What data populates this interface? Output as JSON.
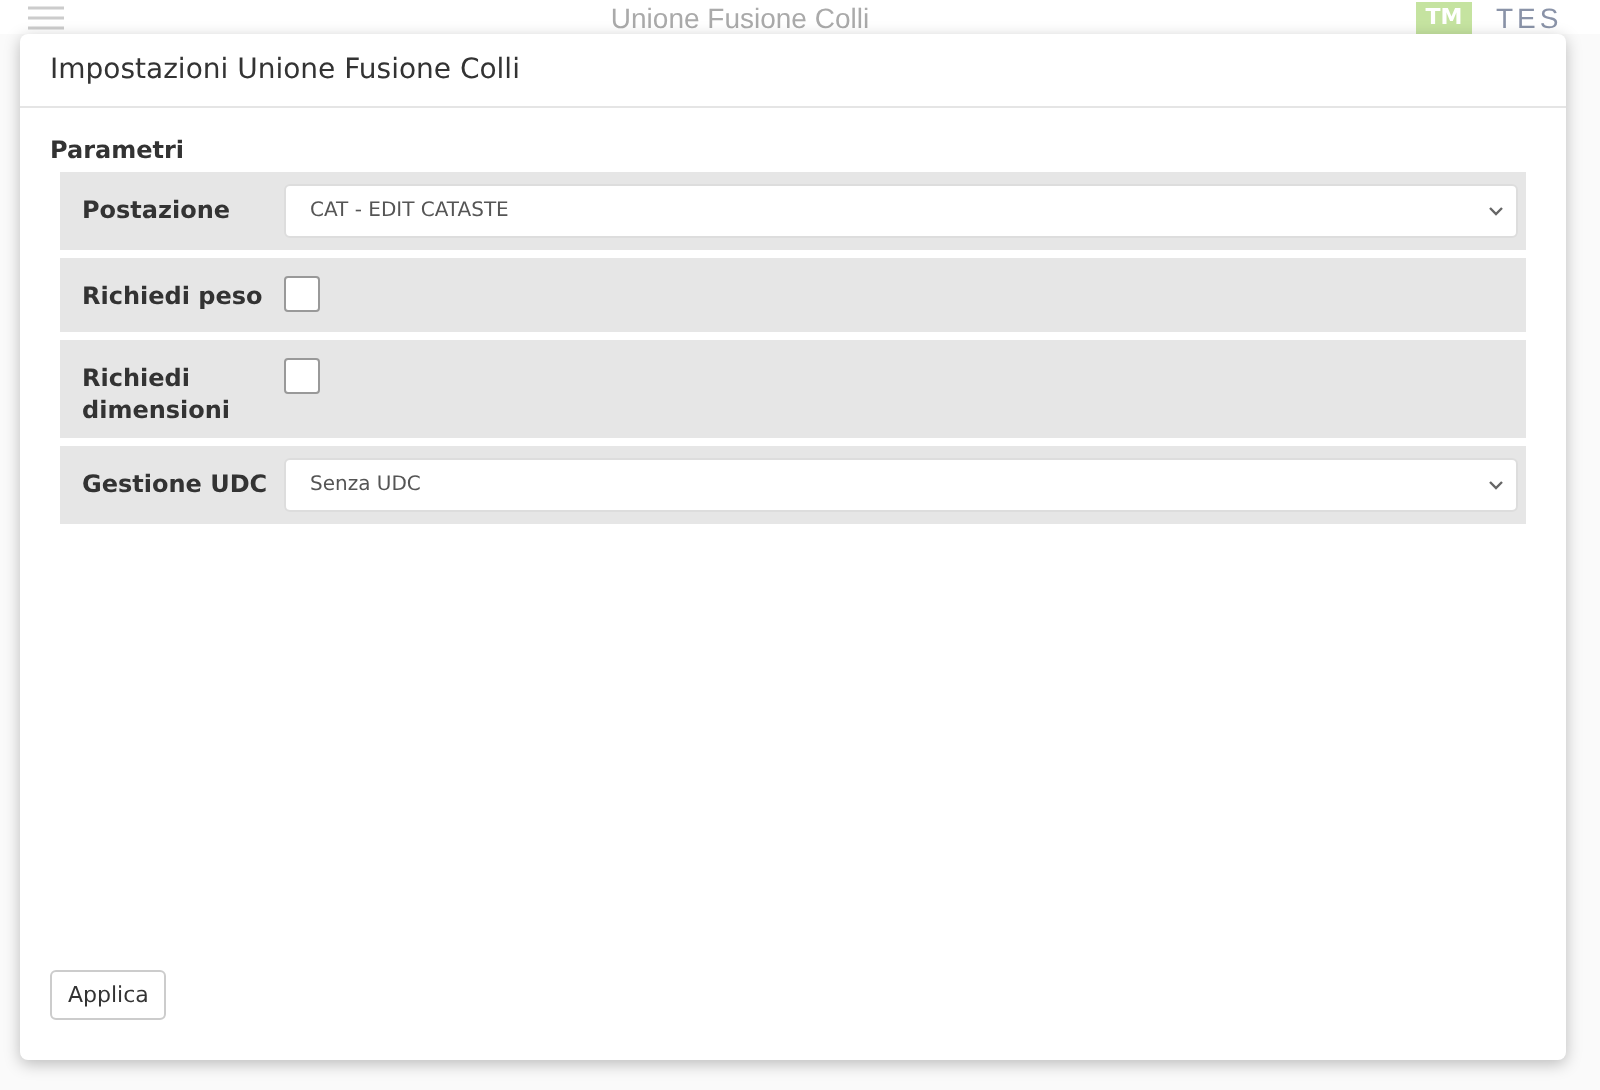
{
  "app_header": {
    "title": "Unione Fusione Colli",
    "badge": "TM",
    "brand": "TES"
  },
  "dialog": {
    "title": "Impostazioni Unione Fusione Colli",
    "section": "Parametri",
    "fields": [
      {
        "kind": "select",
        "label": "Postazione",
        "value": "CAT - EDIT CATASTE"
      },
      {
        "kind": "checkbox",
        "label": "Richiedi peso",
        "checked": false
      },
      {
        "kind": "checkbox",
        "label": "Richiedi dimensioni",
        "checked": false
      },
      {
        "kind": "select",
        "label": "Gestione UDC",
        "value": "Senza UDC"
      }
    ],
    "buttons": [
      "Applica"
    ]
  }
}
